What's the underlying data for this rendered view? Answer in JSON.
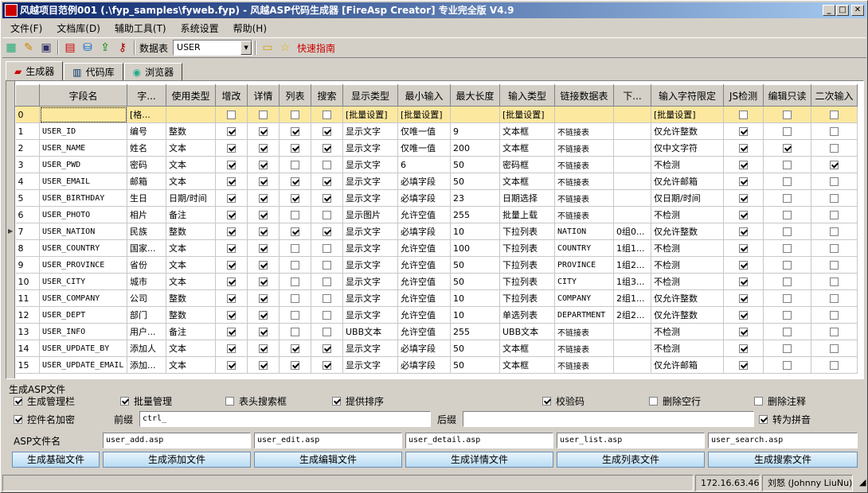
{
  "window": {
    "title": "风越项目范例001 (.\\fyp_samples\\fyweb.fyp) - 风越ASP代码生成器 [FireAsp Creator] 专业完全版 V4.9",
    "buttons": {
      "minimize": "_",
      "maximize": "□",
      "close": "✕"
    }
  },
  "menu": [
    "文件(F)",
    "文档库(D)",
    "辅助工具(T)",
    "系统设置",
    "帮助(H)"
  ],
  "toolbar": {
    "table_label": "数据表",
    "table_value": "USER",
    "quick_guide": "快速指南"
  },
  "tabs": [
    "生成器",
    "代码库",
    "浏览器"
  ],
  "grid": {
    "headers": [
      "",
      "字段名",
      "字...",
      "使用类型",
      "增改",
      "详情",
      "列表",
      "搜索",
      "显示类型",
      "最小输入",
      "最大长度",
      "输入类型",
      "链接数据表",
      "下...",
      "输入字符限定",
      "JS检测",
      "编辑只读",
      "二次输入"
    ],
    "rows": [
      {
        "n": "0",
        "field": "",
        "cn": "[格...",
        "type": "",
        "chk": [
          0,
          0,
          0,
          0
        ],
        "disp": "[批量设置]",
        "min": "[批量设置]",
        "max": "",
        "itype": "[批量设置]",
        "link": "",
        "sub": "",
        "limit": "[批量设置]",
        "js": 0,
        "ro": 0,
        "twice": 0
      },
      {
        "n": "1",
        "field": "USER_ID",
        "cn": "编号",
        "type": "整数",
        "chk": [
          1,
          1,
          1,
          1
        ],
        "disp": "显示文字",
        "min": "仅唯一值",
        "max": "9",
        "itype": "文本框",
        "link": "不链接表",
        "sub": "",
        "limit": "仅允许整数",
        "js": 1,
        "ro": 0,
        "twice": 0
      },
      {
        "n": "2",
        "field": "USER_NAME",
        "cn": "姓名",
        "type": "文本",
        "chk": [
          1,
          1,
          1,
          1
        ],
        "disp": "显示文字",
        "min": "仅唯一值",
        "max": "200",
        "itype": "文本框",
        "link": "不链接表",
        "sub": "",
        "limit": "仅中文字符",
        "js": 1,
        "ro": 1,
        "twice": 0
      },
      {
        "n": "3",
        "field": "USER_PWD",
        "cn": "密码",
        "type": "文本",
        "chk": [
          1,
          1,
          0,
          0
        ],
        "disp": "显示文字",
        "min": "6",
        "max": "50",
        "itype": "密码框",
        "link": "不链接表",
        "sub": "",
        "limit": "不检测",
        "js": 1,
        "ro": 0,
        "twice": 1
      },
      {
        "n": "4",
        "field": "USER_EMAIL",
        "cn": "邮箱",
        "type": "文本",
        "chk": [
          1,
          1,
          1,
          1
        ],
        "disp": "显示文字",
        "min": "必填字段",
        "max": "50",
        "itype": "文本框",
        "link": "不链接表",
        "sub": "",
        "limit": "仅允许邮箱",
        "js": 1,
        "ro": 0,
        "twice": 0
      },
      {
        "n": "5",
        "field": "USER_BIRTHDAY",
        "cn": "生日",
        "type": "日期/时间",
        "chk": [
          1,
          1,
          1,
          1
        ],
        "disp": "显示文字",
        "min": "必填字段",
        "max": "23",
        "itype": "日期选择",
        "link": "不链接表",
        "sub": "",
        "limit": "仅日期/时间",
        "js": 1,
        "ro": 0,
        "twice": 0
      },
      {
        "n": "6",
        "field": "USER_PHOTO",
        "cn": "相片",
        "type": "备注",
        "chk": [
          1,
          1,
          0,
          0
        ],
        "disp": "显示图片",
        "min": "允许空值",
        "max": "255",
        "itype": "批量上载",
        "link": "不链接表",
        "sub": "",
        "limit": "不检测",
        "js": 1,
        "ro": 0,
        "twice": 0
      },
      {
        "n": "7",
        "field": "USER_NATION",
        "cn": "民族",
        "type": "整数",
        "chk": [
          1,
          1,
          1,
          1
        ],
        "disp": "显示文字",
        "min": "必填字段",
        "max": "10",
        "itype": "下拉列表",
        "link": "NATION",
        "sub": "0组0...",
        "limit": "仅允许整数",
        "js": 1,
        "ro": 0,
        "twice": 0
      },
      {
        "n": "8",
        "field": "USER_COUNTRY",
        "cn": "国家...",
        "type": "文本",
        "chk": [
          1,
          1,
          0,
          0
        ],
        "disp": "显示文字",
        "min": "允许空值",
        "max": "100",
        "itype": "下拉列表",
        "link": "COUNTRY",
        "sub": "1组1...",
        "limit": "不检测",
        "js": 1,
        "ro": 0,
        "twice": 0
      },
      {
        "n": "9",
        "field": "USER_PROVINCE",
        "cn": "省份",
        "type": "文本",
        "chk": [
          1,
          1,
          0,
          0
        ],
        "disp": "显示文字",
        "min": "允许空值",
        "max": "50",
        "itype": "下拉列表",
        "link": "PROVINCE",
        "sub": "1组2...",
        "limit": "不检测",
        "js": 1,
        "ro": 0,
        "twice": 0
      },
      {
        "n": "10",
        "field": "USER_CITY",
        "cn": "城市",
        "type": "文本",
        "chk": [
          1,
          1,
          0,
          0
        ],
        "disp": "显示文字",
        "min": "允许空值",
        "max": "50",
        "itype": "下拉列表",
        "link": "CITY",
        "sub": "1组3...",
        "limit": "不检测",
        "js": 1,
        "ro": 0,
        "twice": 0
      },
      {
        "n": "11",
        "field": "USER_COMPANY",
        "cn": "公司",
        "type": "整数",
        "chk": [
          1,
          1,
          0,
          0
        ],
        "disp": "显示文字",
        "min": "允许空值",
        "max": "10",
        "itype": "下拉列表",
        "link": "COMPANY",
        "sub": "2组1...",
        "limit": "仅允许整数",
        "js": 1,
        "ro": 0,
        "twice": 0
      },
      {
        "n": "12",
        "field": "USER_DEPT",
        "cn": "部门",
        "type": "整数",
        "chk": [
          1,
          1,
          0,
          0
        ],
        "disp": "显示文字",
        "min": "允许空值",
        "max": "10",
        "itype": "单选列表",
        "link": "DEPARTMENT",
        "sub": "2组2...",
        "limit": "仅允许整数",
        "js": 1,
        "ro": 0,
        "twice": 0
      },
      {
        "n": "13",
        "field": "USER_INFO",
        "cn": "用户...",
        "type": "备注",
        "chk": [
          1,
          1,
          0,
          0
        ],
        "disp": "UBB文本",
        "min": "允许空值",
        "max": "255",
        "itype": "UBB文本",
        "link": "不链接表",
        "sub": "",
        "limit": "不检测",
        "js": 1,
        "ro": 0,
        "twice": 0
      },
      {
        "n": "14",
        "field": "USER_UPDATE_BY",
        "cn": "添加人",
        "type": "文本",
        "chk": [
          1,
          1,
          1,
          1
        ],
        "disp": "显示文字",
        "min": "必填字段",
        "max": "50",
        "itype": "文本框",
        "link": "不链接表",
        "sub": "",
        "limit": "不检测",
        "js": 1,
        "ro": 0,
        "twice": 0
      },
      {
        "n": "15",
        "field": "USER_UPDATE_EMAIL",
        "cn": "添加...",
        "type": "文本",
        "chk": [
          1,
          1,
          1,
          1
        ],
        "disp": "显示文字",
        "min": "必填字段",
        "max": "50",
        "itype": "文本框",
        "link": "不链接表",
        "sub": "",
        "limit": "仅允许邮箱",
        "js": 1,
        "ro": 0,
        "twice": 0
      }
    ]
  },
  "gen": {
    "legend": "生成ASP文件",
    "opts": {
      "o1": "生成管理栏",
      "o2": "批量管理",
      "o3": "表头搜索框",
      "o4": "提供排序",
      "o5": "校验码",
      "o6": "删除空行",
      "o7": "删除注释",
      "o8": "控件名加密",
      "o9": "转为拼音"
    },
    "prefix_label": "前缀",
    "prefix_value": "ctrl_",
    "suffix_label": "后缀",
    "suffix_value": "",
    "file_label": "ASP文件名",
    "files": [
      "user_add.asp",
      "user_edit.asp",
      "user_detail.asp",
      "user_list.asp",
      "user_search.asp"
    ],
    "buttons": [
      "生成基础文件",
      "生成添加文件",
      "生成编辑文件",
      "生成详情文件",
      "生成列表文件",
      "生成搜索文件"
    ]
  },
  "status": {
    "ip": "172.16.63.46",
    "user": "刘怒 (Johnny LiuNu)"
  }
}
